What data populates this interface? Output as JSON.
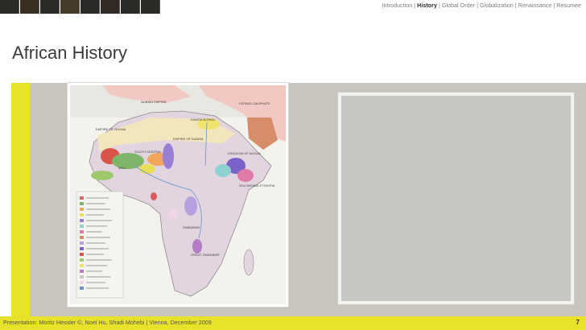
{
  "nav": {
    "items": [
      "Introduction",
      "History",
      "Global Order",
      "Globalization",
      "Renaissance",
      "Resumee"
    ],
    "separator": "|",
    "active_index": 1
  },
  "slide": {
    "title": "African History",
    "page_number": "7"
  },
  "map_labels": {
    "l1": "NUBIAN EMPIRE",
    "l2": "FATIMID CALIPHATE",
    "l3": "EMPIRE OF GHANA",
    "l4": "KANEM-BORNU",
    "l5": "EMPIRE OF KANEM",
    "l6": "SOUTH CENTRAL",
    "l7": "KINGDOM OF AKSUM",
    "l8": "MALI",
    "l9": "SOLOMONID ETHIOPIA",
    "l10": "ZIMBABWE",
    "l11": "GREAT ZIMBABWE"
  },
  "footer": {
    "text": "Presentation: Moritz Hessler ©, Noel Hu, Shadi Mohebi | Vienna, December 2009"
  },
  "colors": {
    "accent_yellow": "#e8e22a",
    "content_gray": "#c7c5be"
  }
}
